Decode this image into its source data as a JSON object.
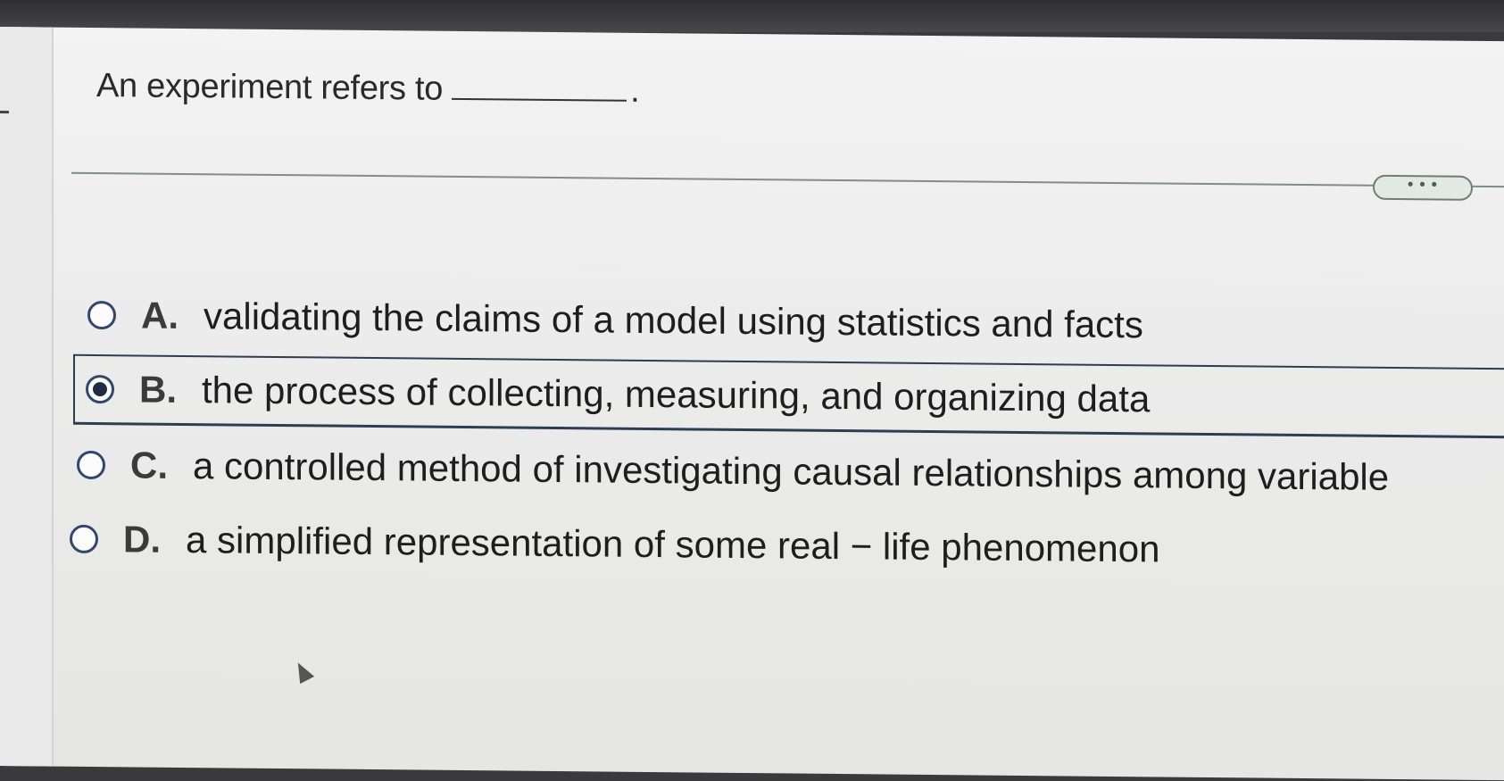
{
  "question": {
    "prompt": "An experiment refers to",
    "end_punctuation": "."
  },
  "more_button": {
    "label": "• • •"
  },
  "options": [
    {
      "letter": "A.",
      "text": "validating the claims of a model using statistics and facts",
      "selected": false
    },
    {
      "letter": "B.",
      "text": "the process of collecting, measuring, and organizing data",
      "selected": true
    },
    {
      "letter": "C.",
      "text": "a controlled method of investigating causal relationships among variable",
      "selected": false
    },
    {
      "letter": "D.",
      "text": "a simplified representation of some real − life phenomenon",
      "selected": false
    }
  ],
  "colors": {
    "radio_border": "#32476b",
    "selected_frame": "#2d3e52",
    "divider": "#7f8f85"
  }
}
